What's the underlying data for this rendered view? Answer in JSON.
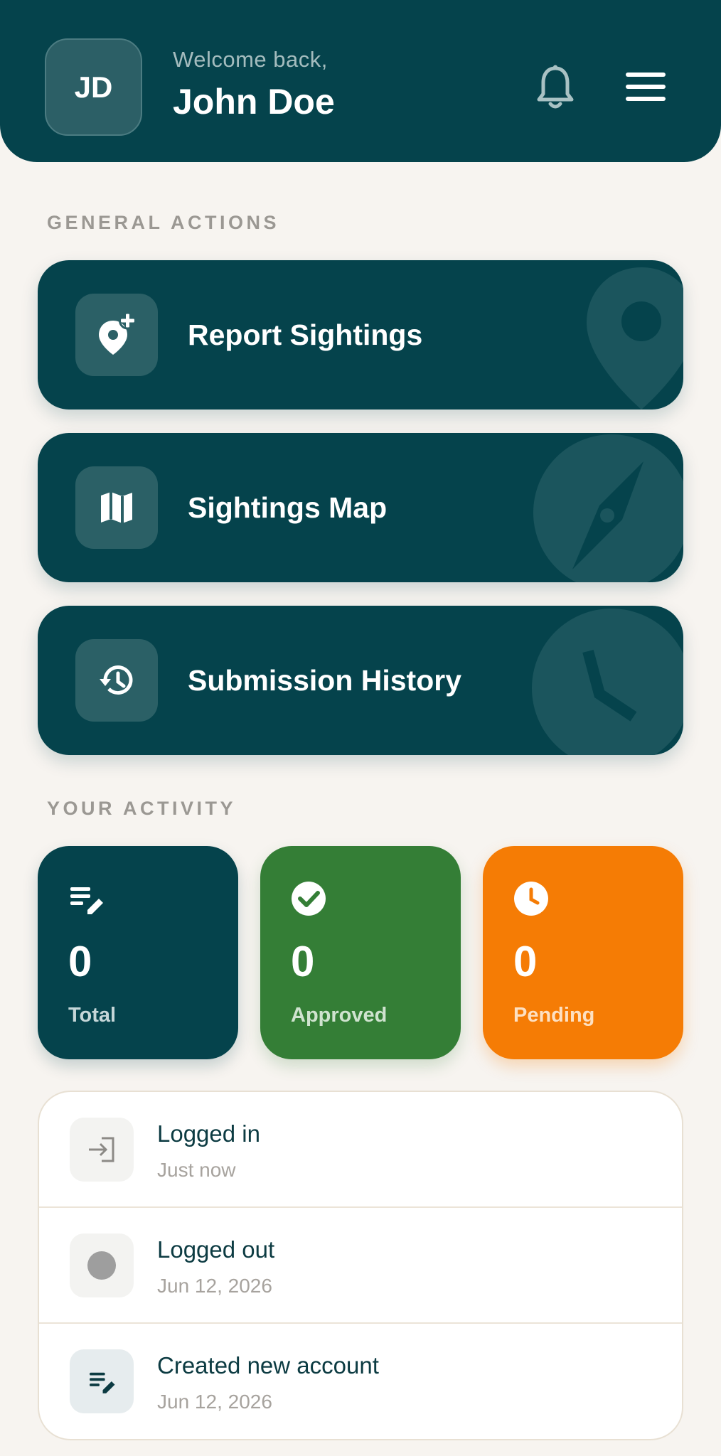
{
  "header": {
    "avatar_initials": "JD",
    "welcome_text": "Welcome back,",
    "user_name": "John Doe",
    "icons": [
      "bell-icon",
      "menu-icon"
    ]
  },
  "general_actions": {
    "section_label": "GENERAL ACTIONS",
    "items": [
      {
        "label": "Report Sightings",
        "icon": "add-location-icon"
      },
      {
        "label": "Sightings Map",
        "icon": "map-icon"
      },
      {
        "label": "Submission History",
        "icon": "history-icon"
      }
    ]
  },
  "activity": {
    "section_label": "YOUR ACTIVITY",
    "stats": [
      {
        "value": "0",
        "label": "Total",
        "color": "#05434c",
        "icon": "edit-list-icon"
      },
      {
        "value": "0",
        "label": "Approved",
        "color": "#347e36",
        "icon": "check-circle-icon"
      },
      {
        "value": "0",
        "label": "Pending",
        "color": "#f57c05",
        "icon": "clock-icon"
      }
    ],
    "log": [
      {
        "title": "Logged in",
        "time": "Just now",
        "icon": "login-icon"
      },
      {
        "title": "Logged out",
        "time": "Jun 12, 2026",
        "icon": "dot-icon"
      },
      {
        "title": "Created new account",
        "time": "Jun 12, 2026",
        "icon": "edit-list-icon"
      }
    ]
  },
  "colors": {
    "primary": "#05434c",
    "approved": "#347e36",
    "pending": "#f57c05",
    "background": "#f7f4f0"
  }
}
